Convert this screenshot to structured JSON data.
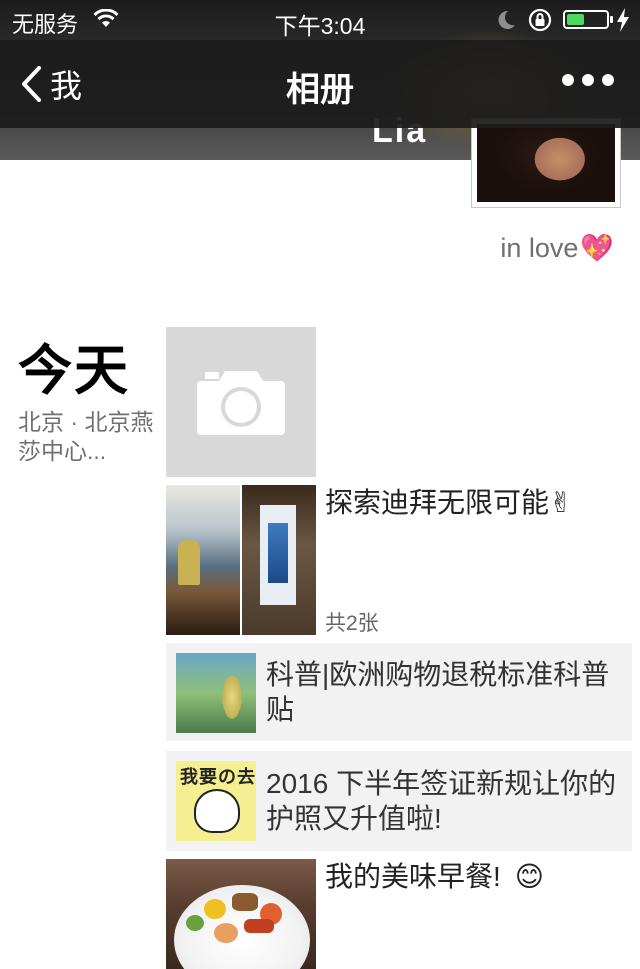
{
  "status_bar": {
    "carrier": "无服务",
    "time": "下午3:04",
    "battery_percent": 45,
    "icons": [
      "wifi-icon",
      "moon-icon",
      "rotation-lock-icon",
      "battery-icon",
      "charging-bolt-icon"
    ]
  },
  "nav": {
    "back_label": "我",
    "title": "相册",
    "more_icon": "more-dots-icon"
  },
  "profile": {
    "name_partial": "Lia",
    "signature": "in love",
    "signature_emoji": "💖"
  },
  "day_group": {
    "day": "今天",
    "location": "北京 · 北京燕莎中心..."
  },
  "posts": {
    "photo": {
      "text": "探索迪拜无限可能",
      "emoji": "✌",
      "count": "共2张"
    },
    "link1": {
      "text": "科普|欧洲购物退税标准科普贴"
    },
    "link2": {
      "thumb_text": "我要の去",
      "text": "2016 下半年签证新规让你的护照又升值啦!"
    },
    "food": {
      "text": "我的美味早餐!",
      "emoji": "😊"
    }
  },
  "colors": {
    "nav_bg": "#1c1c1c",
    "battery_fill": "#4cd964",
    "link_bg": "#f2f2f2",
    "meta_text": "#707070"
  }
}
